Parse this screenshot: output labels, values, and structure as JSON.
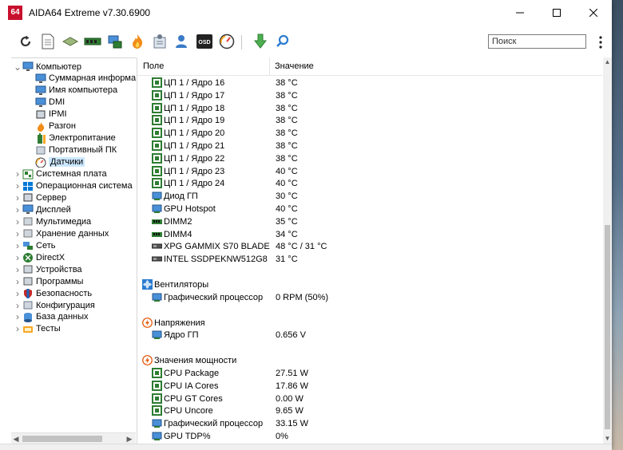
{
  "window": {
    "title": "AIDA64 Extreme v7.30.6900",
    "logo_text": "64"
  },
  "controls": {
    "minimize": "minimize-icon",
    "maximize": "maximize-icon",
    "close": "close-icon"
  },
  "toolbar": {
    "buttons": [
      "refresh-icon",
      "report-icon",
      "motherboard-icon",
      "memory-icon",
      "network-icon",
      "flame-icon",
      "tools-icon",
      "user-icon",
      "osd-icon",
      "gauge-icon",
      "download-icon",
      "search-icon"
    ],
    "osd_label": "OSD"
  },
  "search": {
    "placeholder": "Поиск"
  },
  "tree": {
    "items": [
      {
        "label": "Компьютер",
        "expander": "v"
      },
      {
        "label": "Суммарная информа"
      },
      {
        "label": "Имя компьютера"
      },
      {
        "label": "DMI"
      },
      {
        "label": "IPMI"
      },
      {
        "label": "Разгон"
      },
      {
        "label": "Электропитание"
      },
      {
        "label": "Портативный ПК"
      },
      {
        "label": "Датчики",
        "selected": true
      },
      {
        "label": "Системная плата",
        "expander": ">"
      },
      {
        "label": "Операционная система",
        "expander": ">"
      },
      {
        "label": "Сервер",
        "expander": ">"
      },
      {
        "label": "Дисплей",
        "expander": ">"
      },
      {
        "label": "Мультимедиа",
        "expander": ">"
      },
      {
        "label": "Хранение данных",
        "expander": ">"
      },
      {
        "label": "Сеть",
        "expander": ">"
      },
      {
        "label": "DirectX",
        "expander": ">"
      },
      {
        "label": "Устройства",
        "expander": ">"
      },
      {
        "label": "Программы",
        "expander": ">"
      },
      {
        "label": "Безопасность",
        "expander": ">"
      },
      {
        "label": "Конфигурация",
        "expander": ">"
      },
      {
        "label": "База данных",
        "expander": ">"
      },
      {
        "label": "Тесты",
        "expander": ">"
      }
    ]
  },
  "columns": {
    "field": "Поле",
    "value": "Значение"
  },
  "rows": [
    {
      "field": "ЦП 1 / Ядро 16",
      "value": "38 °C",
      "icon": "cpu"
    },
    {
      "field": "ЦП 1 / Ядро 17",
      "value": "38 °C",
      "icon": "cpu"
    },
    {
      "field": "ЦП 1 / Ядро 18",
      "value": "38 °C",
      "icon": "cpu"
    },
    {
      "field": "ЦП 1 / Ядро 19",
      "value": "38 °C",
      "icon": "cpu"
    },
    {
      "field": "ЦП 1 / Ядро 20",
      "value": "38 °C",
      "icon": "cpu"
    },
    {
      "field": "ЦП 1 / Ядро 21",
      "value": "38 °C",
      "icon": "cpu"
    },
    {
      "field": "ЦП 1 / Ядро 22",
      "value": "38 °C",
      "icon": "cpu"
    },
    {
      "field": "ЦП 1 / Ядро 23",
      "value": "40 °C",
      "icon": "cpu"
    },
    {
      "field": "ЦП 1 / Ядро 24",
      "value": "40 °C",
      "icon": "cpu"
    },
    {
      "field": "Диод ГП",
      "value": "30 °C",
      "icon": "gpu"
    },
    {
      "field": "GPU Hotspot",
      "value": "40 °C",
      "icon": "gpu"
    },
    {
      "field": "DIMM2",
      "value": "35 °C",
      "icon": "dimm"
    },
    {
      "field": "DIMM4",
      "value": "34 °C",
      "icon": "dimm"
    },
    {
      "field": "XPG GAMMIX S70 BLADE",
      "value": "48 °C / 31 °C",
      "icon": "ssd"
    },
    {
      "field": "INTEL SSDPEKNW512G8",
      "value": "31 °C",
      "icon": "ssd"
    },
    {
      "section": "Вентиляторы",
      "icon": "fan"
    },
    {
      "field": "Графический процессор",
      "value": "0 RPM  (50%)",
      "icon": "gpu"
    },
    {
      "section": "Напряжения",
      "icon": "volt"
    },
    {
      "field": "Ядро ГП",
      "value": "0.656 V",
      "icon": "gpu"
    },
    {
      "section": "Значения мощности",
      "icon": "volt"
    },
    {
      "field": "CPU Package",
      "value": "27.51 W",
      "icon": "cpu"
    },
    {
      "field": "CPU IA Cores",
      "value": "17.86 W",
      "icon": "cpu"
    },
    {
      "field": "CPU GT Cores",
      "value": "0.00 W",
      "icon": "cpu"
    },
    {
      "field": "CPU Uncore",
      "value": "9.65 W",
      "icon": "cpu"
    },
    {
      "field": "Графический процессор",
      "value": "33.15 W",
      "icon": "gpu"
    },
    {
      "field": "GPU TDP%",
      "value": "0%",
      "icon": "gpu"
    }
  ]
}
